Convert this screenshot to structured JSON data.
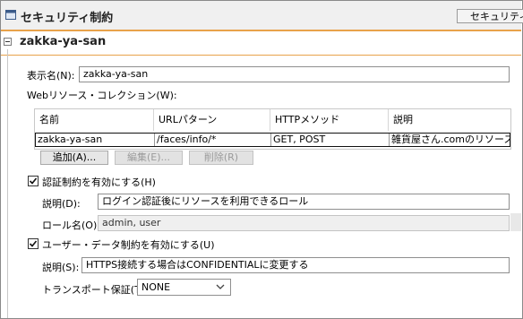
{
  "titlebar": {
    "title": "セキュリティ制約",
    "tab_label": "セキュリティ"
  },
  "section": {
    "title": "zakka-ya-san"
  },
  "display_name": {
    "label": "表示名(N):",
    "value": "zakka-ya-san"
  },
  "web_resources": {
    "label": "Webリソース・コレクション(W):",
    "columns": [
      "名前",
      "URLパターン",
      "HTTPメソッド",
      "説明"
    ],
    "rows": [
      [
        "zakka-ya-san",
        "/faces/info/*",
        "GET, POST",
        "雑貨屋さん.comのリソース"
      ]
    ],
    "buttons": {
      "add": "追加(A)...",
      "edit": "編集(E)...",
      "delete": "削除(R)"
    }
  },
  "auth_constraint": {
    "checkbox_label": "認証制約を有効にする(H)",
    "checked": true,
    "description_label": "説明(D):",
    "description_value": "ログイン認証後にリソースを利用できるロール",
    "roles_label": "ロール名(O):",
    "roles_value": "admin, user"
  },
  "user_data_constraint": {
    "checkbox_label": "ユーザー・データ制約を有効にする(U)",
    "checked": true,
    "description_label": "説明(S):",
    "description_value": "HTTPS接続する場合はCONFIDENTIALに変更する",
    "transport_label": "トランスポート保証(T):",
    "transport_value": "NONE"
  },
  "icons": {
    "title_icon": "window-icon",
    "check": "checkmark-icon",
    "dropdown": "chevron-down-icon",
    "collapse": "collapse-icon"
  },
  "colors": {
    "accent_line": "#e8a24a"
  }
}
